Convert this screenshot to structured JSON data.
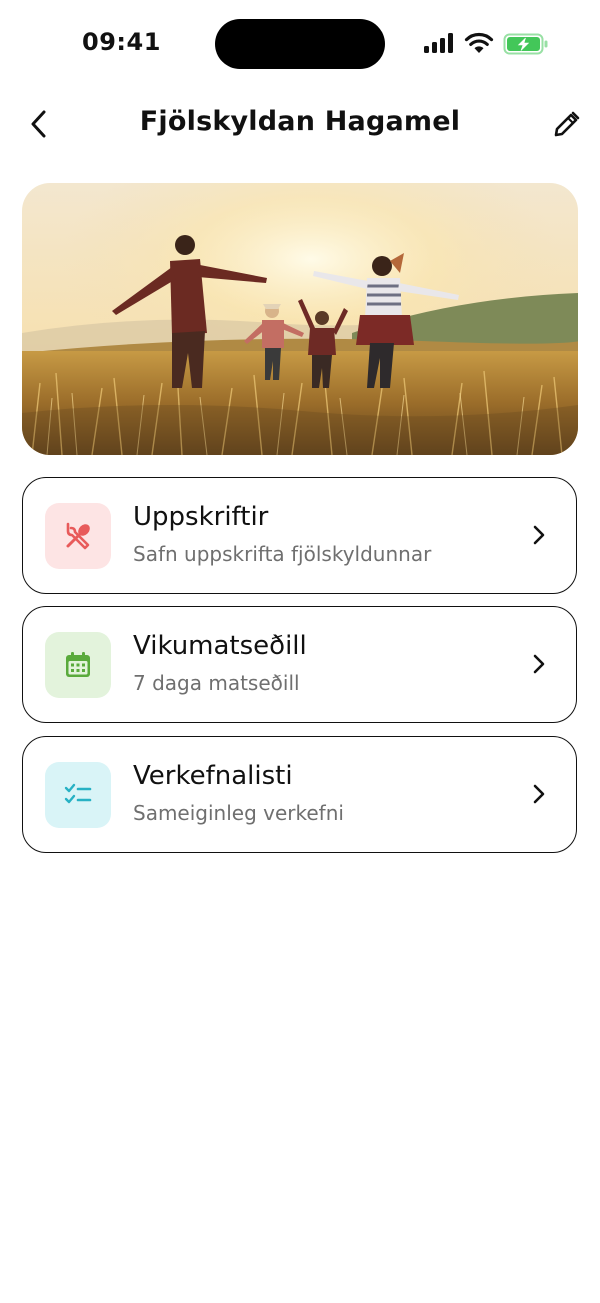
{
  "status_bar": {
    "time": "09:41"
  },
  "header": {
    "title": "Fjölskyldan Hagamel"
  },
  "cards": [
    {
      "title": "Uppskriftir",
      "subtitle": "Safn uppskrifta fjölskyldunnar",
      "icon": "cutlery-icon",
      "icon_bg": "#fde4e4",
      "icon_color": "#e85a5a"
    },
    {
      "title": "Vikumatseðill",
      "subtitle": "7 daga matseðill",
      "icon": "calendar-icon",
      "icon_bg": "#e3f3dc",
      "icon_color": "#5aaa3c"
    },
    {
      "title": "Verkefnalisti",
      "subtitle": "Sameiginleg verkefni",
      "icon": "checklist-icon",
      "icon_bg": "#d9f4f7",
      "icon_color": "#27b1c4"
    }
  ],
  "colors": {
    "text": "#111111",
    "subtext": "#6f6f6f",
    "battery_green": "#43c759"
  }
}
